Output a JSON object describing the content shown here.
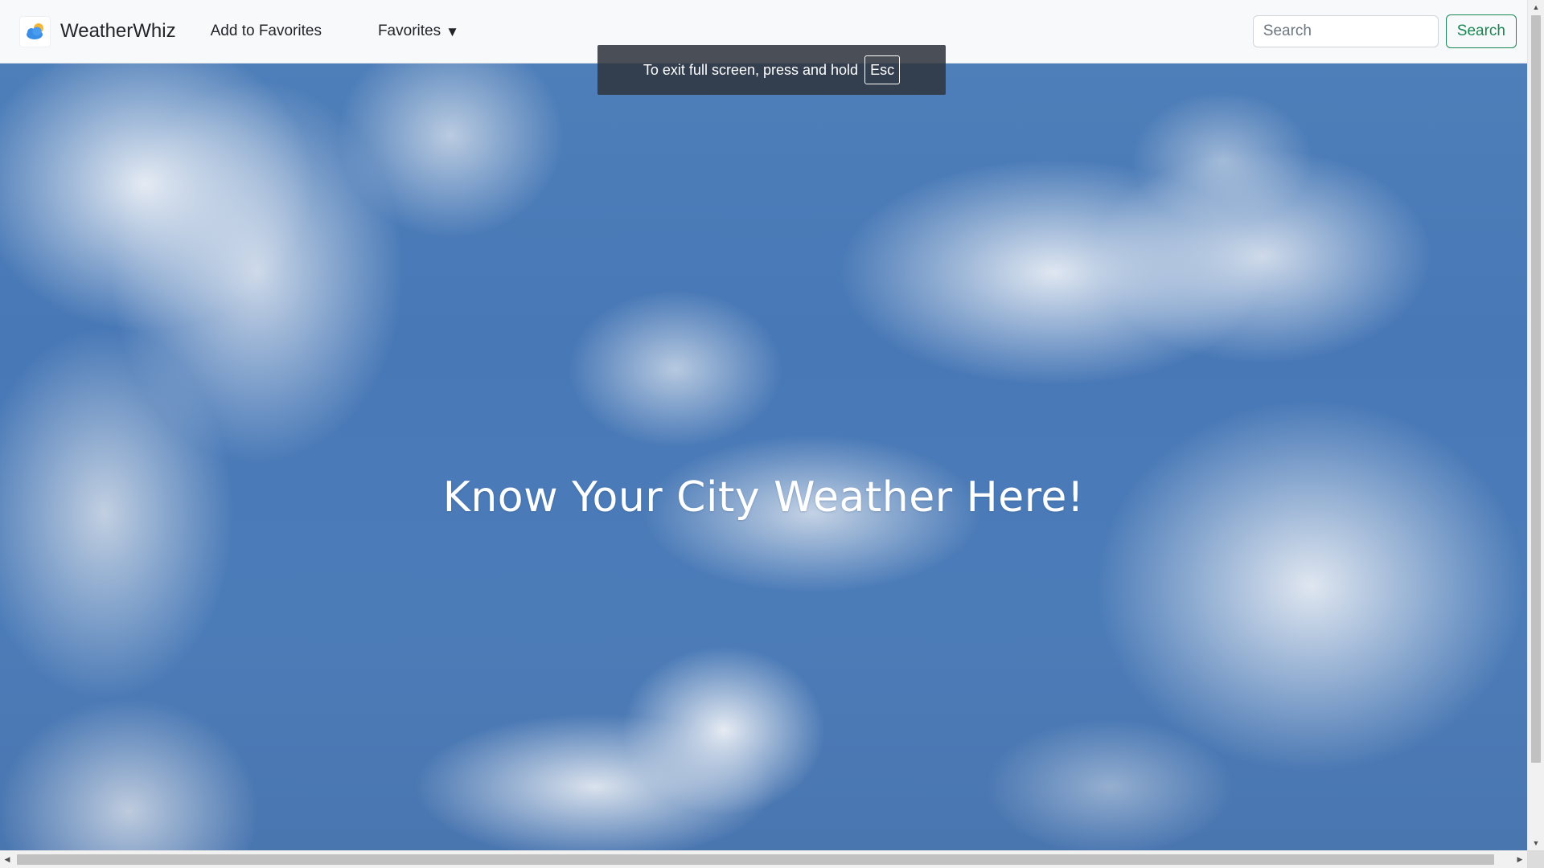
{
  "navbar": {
    "brand_name": "WeatherWhiz",
    "brand_icon": "cloud-sun-icon",
    "add_favorites_label": "Add to Favorites",
    "favorites_label": "Favorites",
    "favorites_caret": "▼",
    "search": {
      "placeholder": "Search",
      "value": "",
      "button_label": "Search"
    }
  },
  "hero": {
    "title": "Know Your City Weather Here!"
  },
  "fullscreen_notice": {
    "text": "To exit full screen, press and hold",
    "key": "Esc"
  },
  "scrollbars": {
    "vertical_up": "▲",
    "vertical_down": "▼",
    "horizontal_left": "◀",
    "horizontal_right": "▶"
  },
  "colors": {
    "navbar_bg": "#f8f9fa",
    "search_button": "#198754",
    "sky": "#4878b6",
    "hero_text": "#ffffff"
  }
}
